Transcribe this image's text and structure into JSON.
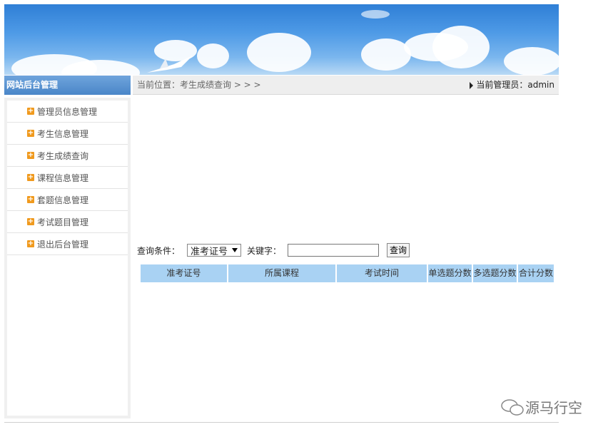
{
  "sidebar": {
    "title": "网站后台管理",
    "items": [
      {
        "label": "管理员信息管理"
      },
      {
        "label": "考生信息管理"
      },
      {
        "label": "考生成绩查询"
      },
      {
        "label": "课程信息管理"
      },
      {
        "label": "套题信息管理"
      },
      {
        "label": "考试题目管理"
      },
      {
        "label": "退出后台管理"
      }
    ]
  },
  "breadcrumb": {
    "location": "当前位置：考生成绩查询 > > >",
    "admin": "当前管理员：admin"
  },
  "search": {
    "condition_label": "查询条件：",
    "selected_option": "准考证号",
    "keyword_label": "关键字：",
    "keyword_value": "",
    "button_label": "查询"
  },
  "table": {
    "headers": [
      "准考证号",
      "所属课程",
      "考试时间",
      "单选题分数",
      "多选题分数",
      "合计分数"
    ]
  },
  "watermark": {
    "text": "源马行空"
  },
  "colors": {
    "sidebar_title_bg": "#4a86c8",
    "table_header_bg": "#a9d2f3",
    "icon_orange": "#f09a1e"
  }
}
